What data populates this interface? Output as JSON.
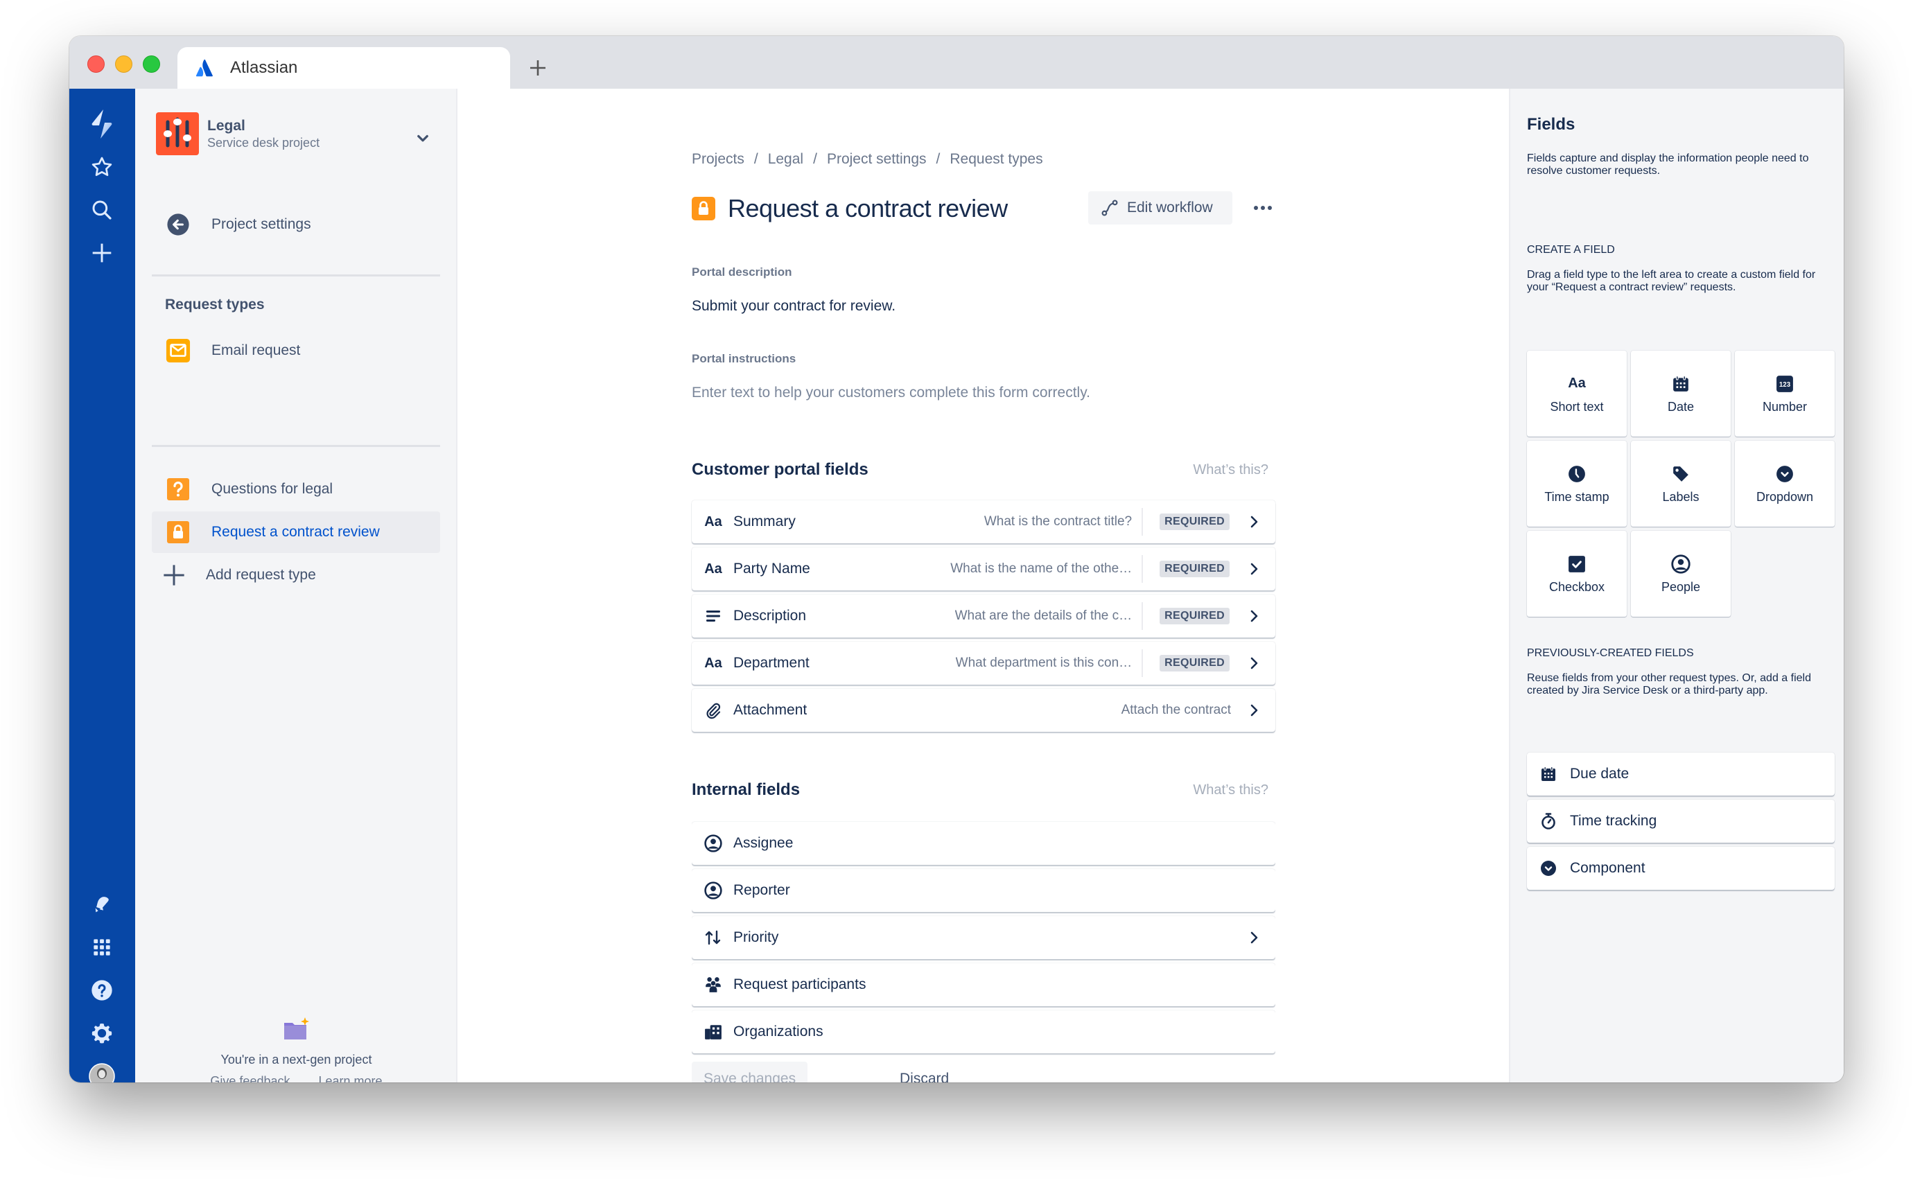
{
  "browser": {
    "tab_title": "Atlassian",
    "tab_icon": "atlassian-logo",
    "new_tab_icon": "plus-icon"
  },
  "nav_rail": {
    "top_icons": [
      "jira-service-desk-logo",
      "star-icon",
      "search-icon",
      "plus-icon"
    ],
    "bottom_icons": [
      "notification-bell-icon",
      "app-switcher-icon",
      "help-icon",
      "settings-icon",
      "user-avatar"
    ]
  },
  "sidebar": {
    "project": {
      "name": "Legal",
      "type": "Service desk project",
      "color": "#FF5630"
    },
    "back_link": "Project settings",
    "section_title": "Request types",
    "items": [
      {
        "label": "Email request",
        "icon": "email-icon",
        "color": "#FFAB00",
        "active": false
      },
      {
        "label": "Questions for legal",
        "icon": "question-icon",
        "color": "#FF8B00",
        "active": false
      },
      {
        "label": "Request a contract review",
        "icon": "lock-icon",
        "color": "#FF8B00",
        "active": true
      }
    ],
    "add_label": "Add request type",
    "footer": {
      "text": "You're in a next-gen project",
      "give_feedback": "Give feedback",
      "learn_more": "Learn more"
    }
  },
  "main": {
    "breadcrumbs": [
      "Projects",
      "Legal",
      "Project settings",
      "Request types"
    ],
    "title": "Request a contract review",
    "edit_workflow": "Edit workflow",
    "portal_description_label": "Portal description",
    "portal_description": "Submit your contract for review.",
    "portal_instructions_label": "Portal instructions",
    "portal_instructions_placeholder": "Enter text to help your customers complete this form correctly.",
    "customer_fields_title": "Customer portal fields",
    "whats_this": "What’s this?",
    "customer_fields": [
      {
        "icon": "text-icon",
        "name": "Summary",
        "desc": "What is the contract title?",
        "required": "REQUIRED"
      },
      {
        "icon": "text-icon",
        "name": "Party Name",
        "desc": "What is the name of the othe…",
        "required": "REQUIRED"
      },
      {
        "icon": "paragraph-icon",
        "name": "Description",
        "desc": "What are the details of the c…",
        "required": "REQUIRED"
      },
      {
        "icon": "text-icon",
        "name": "Department",
        "desc": "What department is this con…",
        "required": "REQUIRED"
      },
      {
        "icon": "attachment-icon",
        "name": "Attachment",
        "desc": "Attach the contract",
        "required": null
      }
    ],
    "internal_fields_title": "Internal fields",
    "internal_fields": [
      {
        "icon": "person-circle-icon",
        "name": "Assignee",
        "chevron": false
      },
      {
        "icon": "person-circle-icon",
        "name": "Reporter",
        "chevron": false
      },
      {
        "icon": "priority-icon",
        "name": "Priority",
        "chevron": true
      },
      {
        "icon": "people-group-icon",
        "name": "Request participants",
        "chevron": false
      },
      {
        "icon": "organization-icon",
        "name": "Organizations",
        "chevron": false
      }
    ],
    "save_label": "Save changes",
    "discard_label": "Discard"
  },
  "right_panel": {
    "title": "Fields",
    "description": "Fields capture and display the information people need to resolve customer requests.",
    "create_title": "CREATE A FIELD",
    "create_desc": "Drag a field type to the left area to create a custom field for your “Request a contract review” requests.",
    "field_types": [
      {
        "label": "Short text",
        "icon": "text-icon"
      },
      {
        "label": "Date",
        "icon": "calendar-icon"
      },
      {
        "label": "Number",
        "icon": "number-icon"
      },
      {
        "label": "Time stamp",
        "icon": "clock-icon"
      },
      {
        "label": "Labels",
        "icon": "label-icon"
      },
      {
        "label": "Dropdown",
        "icon": "dropdown-icon"
      },
      {
        "label": "Checkbox",
        "icon": "checkbox-icon"
      },
      {
        "label": "People",
        "icon": "person-circle-icon"
      }
    ],
    "previous_title": "PREVIOUSLY-CREATED FIELDS",
    "previous_desc": "Reuse fields from your other request types. Or, add a field created by Jira Service Desk or a third-party app.",
    "previous_fields": [
      {
        "label": "Due date",
        "icon": "calendar-icon"
      },
      {
        "label": "Time tracking",
        "icon": "stopwatch-icon"
      },
      {
        "label": "Component",
        "icon": "dropdown-icon"
      }
    ]
  },
  "colors": {
    "nav_blue": "#0747A6",
    "link_blue": "#0052CC",
    "text_dark": "#172B4D",
    "text_subtle": "#6B778C",
    "panel_bg": "#F4F5F7"
  }
}
